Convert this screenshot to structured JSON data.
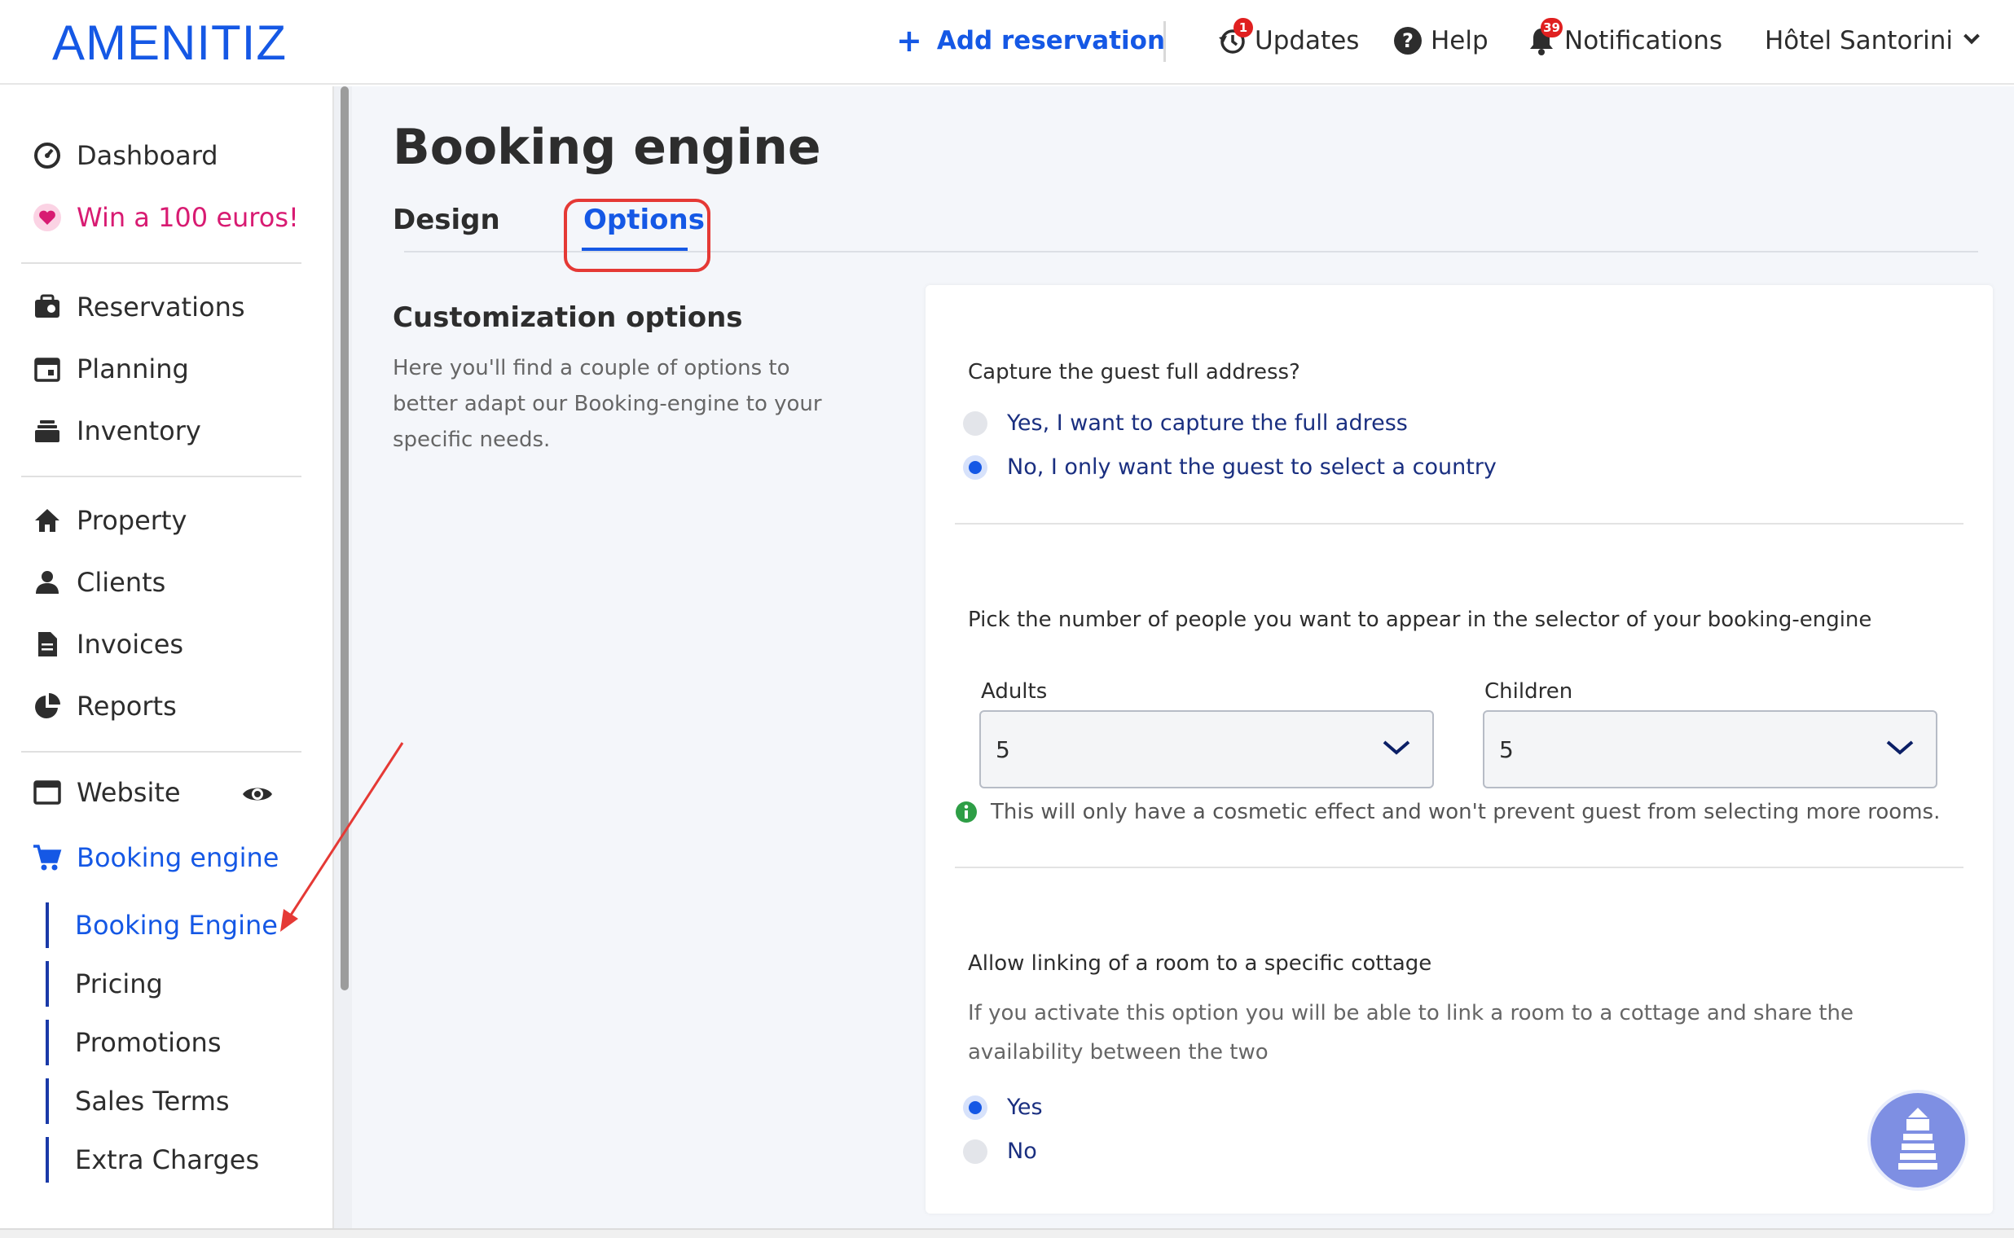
{
  "topbar": {
    "logo": "AMENITIZ",
    "add_reservation": "Add reservation",
    "updates": "Updates",
    "updates_badge": "1",
    "help": "Help",
    "notifications": "Notifications",
    "notifications_badge": "39",
    "hotel": "Hôtel Santorini"
  },
  "sidebar": {
    "dashboard": "Dashboard",
    "win": "Win a 100 euros!",
    "reservations": "Reservations",
    "planning": "Planning",
    "inventory": "Inventory",
    "property": "Property",
    "clients": "Clients",
    "invoices": "Invoices",
    "reports": "Reports",
    "website": "Website",
    "booking_engine": "Booking engine",
    "sub": [
      "Booking Engine",
      "Pricing",
      "Promotions",
      "Sales Terms",
      "Extra Charges"
    ]
  },
  "page": {
    "title": "Booking engine",
    "tabs": [
      "Design",
      "Options"
    ],
    "customization_title": "Customization options",
    "customization_desc": "Here you'll find a couple of options to better adapt our Booking-engine to your specific needs."
  },
  "options": {
    "address_question": "Capture the guest full address?",
    "address_yes": "Yes, I want to capture the full adress",
    "address_no": "No, I only want the guest to select a country",
    "people_question": "Pick the number of people you want to appear in the selector of your booking-engine",
    "adults_label": "Adults",
    "adults_value": "5",
    "children_label": "Children",
    "children_value": "5",
    "info_text": "This will only have a cosmetic effect and won't prevent guest from selecting more rooms.",
    "cottage_question": "Allow linking of a room to a specific cottage",
    "cottage_desc": "If you activate this option you will be able to link a room to a cottage and share the availability between the two",
    "cottage_yes": "Yes",
    "cottage_no": "No"
  },
  "colors": {
    "brand": "#1558e5",
    "accent_pink": "#d81b72",
    "annotation_red": "#e53935"
  }
}
